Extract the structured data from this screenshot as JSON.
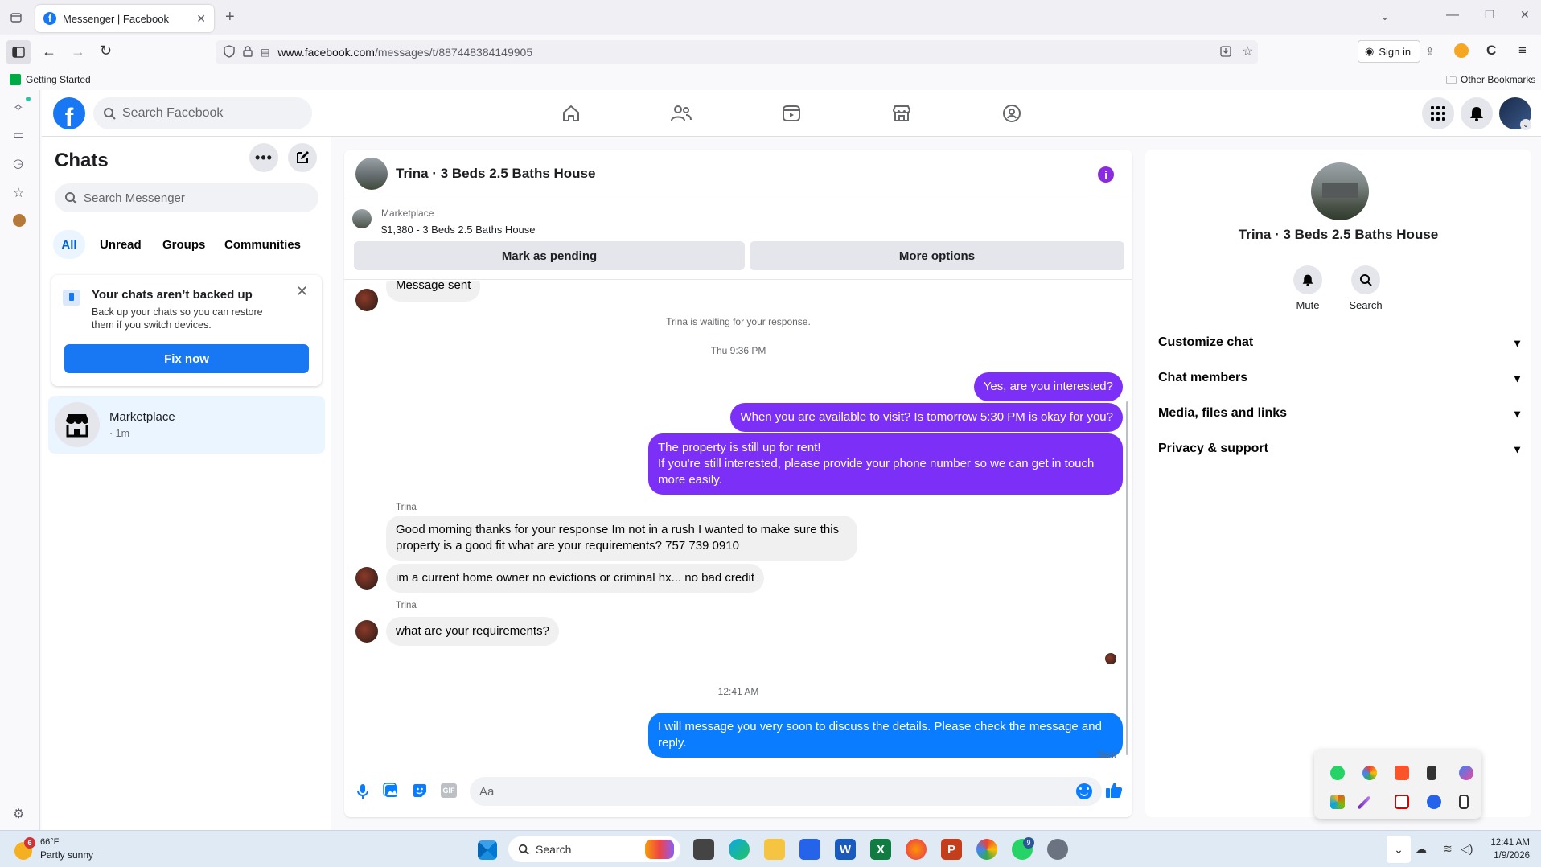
{
  "browser": {
    "tab_title": "Messenger | Facebook",
    "url_domain": "www.facebook.com",
    "url_path": "/messages/t/887448384149905",
    "sign_in": "Sign in",
    "bookmark_getting_started": "Getting Started",
    "bookmark_other": "Other Bookmarks"
  },
  "fb": {
    "search_placeholder": "Search Facebook",
    "nav": [
      "home-icon",
      "friends-icon",
      "watch-icon",
      "marketplace-icon",
      "groups-icon"
    ]
  },
  "chats": {
    "title": "Chats",
    "search_placeholder": "Search Messenger",
    "filters": [
      "All",
      "Unread",
      "Groups",
      "Communities"
    ],
    "backup_title": "Your chats aren’t backed up",
    "backup_body": "Back up your chats so you can restore them if you switch devices.",
    "backup_button": "Fix now",
    "item_name": "Marketplace",
    "item_time": "· 1m"
  },
  "conversation": {
    "title": "Trina · 3 Beds 2.5 Baths House",
    "marketplace_label": "Marketplace",
    "listing": "$1,380 - 3 Beds 2.5 Baths House",
    "mark_pending": "Mark as pending",
    "more_options": "More options",
    "msg_sent_partial": "Message sent",
    "waiting": "Trina is waiting for your response.",
    "time1": "Thu 9:36 PM",
    "out1": "Yes, are you interested?",
    "out2": "When you are available to visit? Is tomorrow 5:30 PM is okay for you?",
    "out3_line1": "The property is still up for rent!",
    "out3_line2": "If you're still interested, please provide your phone number so we can get in touch more easily.",
    "sender1": "Trina",
    "in1": "Good morning thanks for your response Im not in a rush I wanted to make sure this property is a good fit  what are your requirements? 757 739 0910",
    "in2": "im a current home owner no evictions or criminal hx... no bad credit",
    "sender2": "Trina",
    "in3": "what are your requirements?",
    "time2": "12:41 AM",
    "out4": "I will message you very soon to discuss the details. Please check the message and reply.",
    "sent": "Sent",
    "composer_placeholder": "Aa"
  },
  "details": {
    "title": "Trina · 3 Beds 2.5 Baths House",
    "mute": "Mute",
    "search": "Search",
    "sections": [
      "Customize chat",
      "Chat members",
      "Media, files and links",
      "Privacy & support"
    ]
  },
  "taskbar": {
    "weather_temp": "66°F",
    "weather_desc": "Partly sunny",
    "weather_badge": "6",
    "search": "Search",
    "time": "12:41 AM",
    "date": "1/9/2026",
    "whatsapp_badge": "9"
  },
  "colors": {
    "fb_blue": "#1877f2",
    "bubble_purple": "#7b2ff7",
    "bubble_blue": "#0a7cff"
  }
}
